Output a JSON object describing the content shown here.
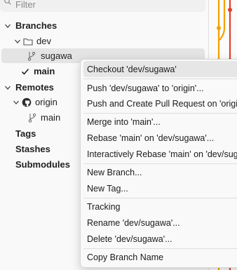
{
  "filter": {
    "placeholder": "Filter",
    "icon": "search-icon"
  },
  "tree": {
    "branches_header": "Branches",
    "folder_dev": "dev",
    "branch_sugawa": "sugawa",
    "branch_main": "main",
    "remotes_header": "Remotes",
    "remote_origin": "origin",
    "remote_main": "main",
    "tags": "Tags",
    "stashes": "Stashes",
    "submodules": "Submodules"
  },
  "context_menu": {
    "items": [
      "Checkout 'dev/sugawa'",
      "Push 'dev/sugawa' to 'origin'...",
      "Push and Create Pull Request on 'origin'...",
      "Merge into 'main'...",
      "Rebase 'main' on 'dev/sugawa'...",
      "Interactively Rebase 'main' on 'dev/sugawa'...",
      "New Branch...",
      "New Tag...",
      "Tracking",
      "Rename 'dev/sugawa'...",
      "Delete 'dev/sugawa'...",
      "Copy Branch Name"
    ]
  },
  "colors": {
    "graph_orange": "#f5a000",
    "graph_red": "#e0402a",
    "hover": "#e6e6e6",
    "selected": "#e4e4e4"
  }
}
